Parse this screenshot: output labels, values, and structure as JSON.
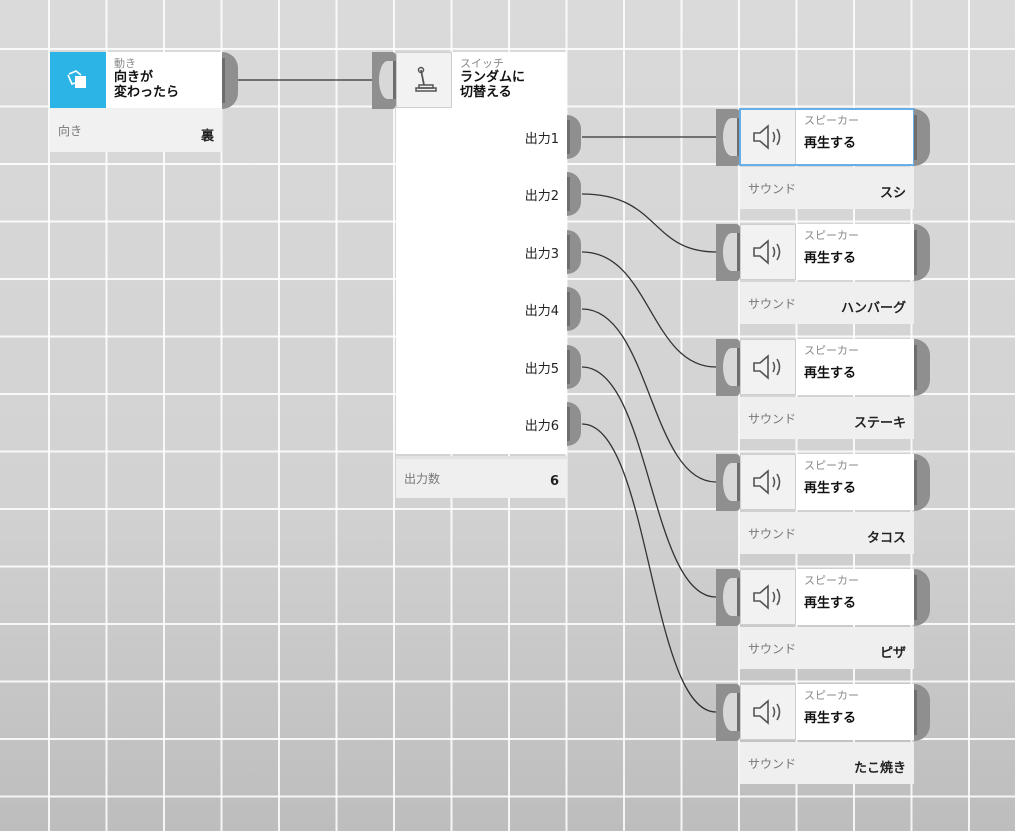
{
  "colors": {
    "accent": "#2cb4e6",
    "selected_outline": "#6aaee8"
  },
  "motion_node": {
    "category": "動き",
    "title": "向きが\n変わったら",
    "icon": "rotate-cards-icon",
    "param_label": "向き",
    "param_value": "裏"
  },
  "switch_node": {
    "category": "スイッチ",
    "title": "ランダムに\n切替える",
    "icon": "lever-switch-icon",
    "outputs": [
      "出力1",
      "出力2",
      "出力3",
      "出力4",
      "出力5",
      "出力6"
    ],
    "param_label": "出力数",
    "param_value": "6"
  },
  "speakers": [
    {
      "category": "スピーカー",
      "title": "再生する",
      "param_label": "サウンド",
      "param_value": "スシ",
      "icon": "speaker-icon",
      "selected": true
    },
    {
      "category": "スピーカー",
      "title": "再生する",
      "param_label": "サウンド",
      "param_value": "ハンバーグ",
      "icon": "speaker-icon"
    },
    {
      "category": "スピーカー",
      "title": "再生する",
      "param_label": "サウンド",
      "param_value": "ステーキ",
      "icon": "speaker-icon"
    },
    {
      "category": "スピーカー",
      "title": "再生する",
      "param_label": "サウンド",
      "param_value": "タコス",
      "icon": "speaker-icon"
    },
    {
      "category": "スピーカー",
      "title": "再生する",
      "param_label": "サウンド",
      "param_value": "ピザ",
      "icon": "speaker-icon"
    },
    {
      "category": "スピーカー",
      "title": "再生する",
      "param_label": "サウンド",
      "param_value": "たこ焼き",
      "icon": "speaker-icon"
    }
  ]
}
